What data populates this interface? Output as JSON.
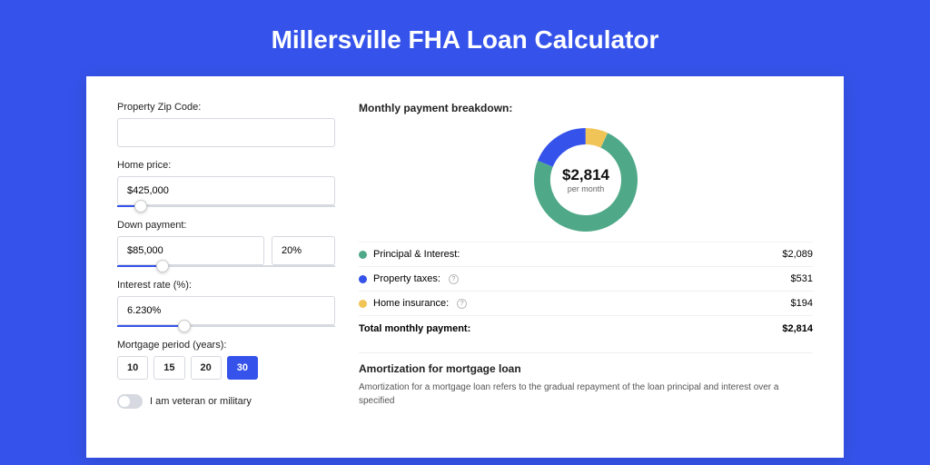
{
  "title": "Millersville FHA Loan Calculator",
  "left": {
    "zip_label": "Property Zip Code:",
    "zip_value": "",
    "home_price_label": "Home price:",
    "home_price_value": "$425,000",
    "down_payment_label": "Down payment:",
    "down_payment_value": "$85,000",
    "down_payment_pct": "20%",
    "interest_label": "Interest rate (%):",
    "interest_value": "6.230%",
    "period_label": "Mortgage period (years):",
    "periods": [
      "10",
      "15",
      "20",
      "30"
    ],
    "period_active": "30",
    "veteran_label": "I am veteran or military"
  },
  "right": {
    "breakdown_title": "Monthly payment breakdown:",
    "center_value": "$2,814",
    "center_sub": "per month",
    "rows": [
      {
        "label": "Principal & Interest:",
        "value": "$2,089"
      },
      {
        "label": "Property taxes:",
        "value": "$531"
      },
      {
        "label": "Home insurance:",
        "value": "$194"
      }
    ],
    "total_label": "Total monthly payment:",
    "total_value": "$2,814",
    "amort_title": "Amortization for mortgage loan",
    "amort_text": "Amortization for a mortgage loan refers to the gradual repayment of the loan principal and interest over a specified"
  },
  "chart_data": {
    "type": "pie",
    "title": "Monthly payment breakdown",
    "series": [
      {
        "name": "Principal & Interest",
        "value": 2089,
        "color": "#4fa989"
      },
      {
        "name": "Property taxes",
        "value": 531,
        "color": "#3553ea"
      },
      {
        "name": "Home insurance",
        "value": 194,
        "color": "#f0c456"
      }
    ],
    "total": 2814
  }
}
